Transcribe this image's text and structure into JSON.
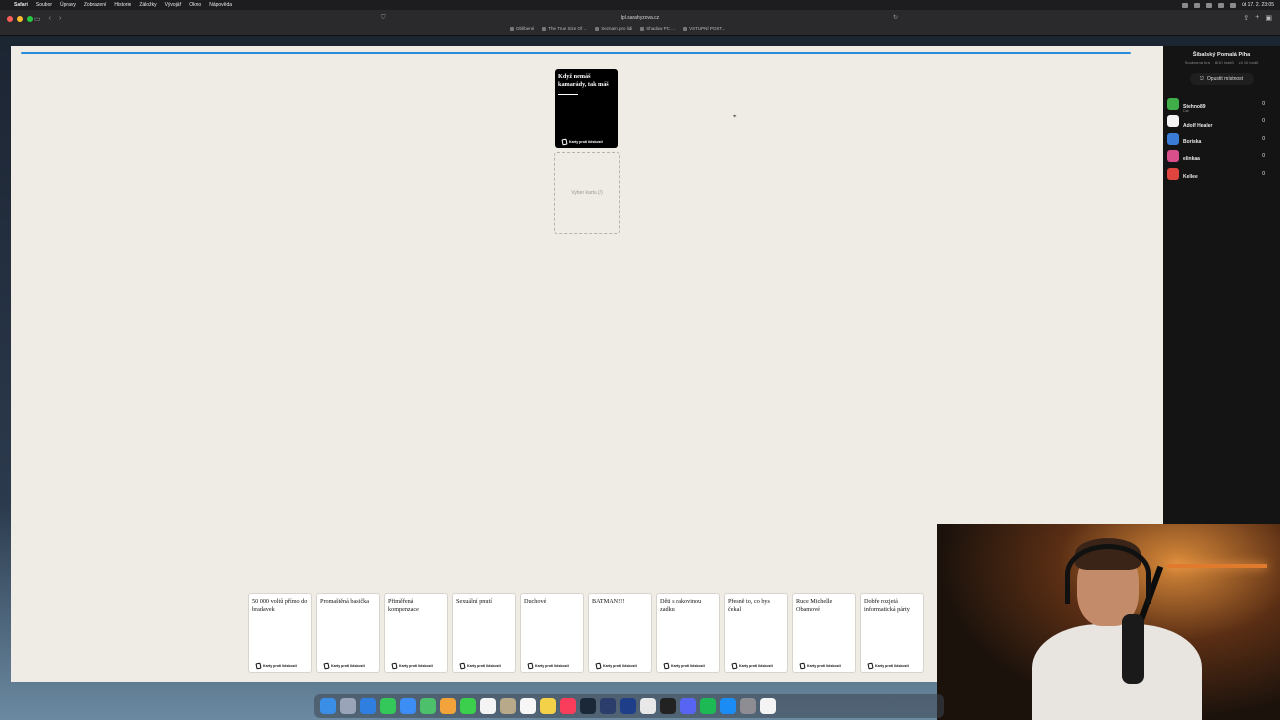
{
  "menubar": {
    "items": [
      "Safari",
      "Soubor",
      "Úpravy",
      "Zobrazení",
      "Historie",
      "Záložky",
      "Vývojář",
      "Okno",
      "Nápověda"
    ],
    "clock": "út 17. 2.  23:05"
  },
  "browser": {
    "url": "lpl.sarahyzova.cz",
    "bookmarks": [
      "Oblíbené",
      "The True Size Of ...",
      "Seznam pro lidi",
      "Shadow PC ...",
      "VSTUPNÍ POST..."
    ]
  },
  "game": {
    "black_card": "Když nemáš kamarády, tak máš",
    "brand": "Karty proti lidskosti",
    "drop_slot": "Vyber kartu (/)",
    "hand": [
      "50 000 voltů přímo do bradavek",
      "Promaštěná basička",
      "Přiměřená kompenzace",
      "Sexuální pnutí",
      "Duchové",
      "BATMAN!!!",
      "Děti s rakovinou zadku",
      "Přesně to, co bys čekal",
      "Ruce Michelle Obamové",
      "Dobře rozjetá informatická párty"
    ]
  },
  "sidebar": {
    "room_name": "Šibalský Pomalá Píha",
    "room_meta": [
      "Soukromá hra",
      "8/10 hráčů",
      "cíl 10 bodů"
    ],
    "leave_label": "Opustit místnost",
    "czar_label": "Car",
    "players": [
      {
        "name": "Stehno89",
        "score": "0",
        "color": "#3fae49"
      },
      {
        "name": "Adolf Healer",
        "score": "0",
        "color": "#f4f4f4",
        "czar": true
      },
      {
        "name": "Boriska",
        "score": "0",
        "color": "#3a7bd5"
      },
      {
        "name": "elinkaa",
        "score": "0",
        "color": "#d94f8c"
      },
      {
        "name": "Kellee",
        "score": "0",
        "color": "#e0443e"
      }
    ]
  },
  "colors": {
    "accent": "#2a8bd8",
    "page_bg": "#efebe5",
    "sidebar_bg": "#141414",
    "black_card": "#000000"
  },
  "dock_icons": [
    "finder-icon",
    "launchpad-icon",
    "safari-icon",
    "messages-icon",
    "mail-icon",
    "maps-icon",
    "photos-icon",
    "facetime-icon",
    "calendar-icon",
    "contacts-icon",
    "reminders-icon",
    "notes-icon",
    "music-icon",
    "steam-icon",
    "lightroom-icon",
    "photoshop-icon",
    "chatgpt-icon",
    "tv-icon",
    "discord-icon",
    "spotify-icon",
    "appstore-icon",
    "settings-icon",
    "chrome-icon"
  ]
}
